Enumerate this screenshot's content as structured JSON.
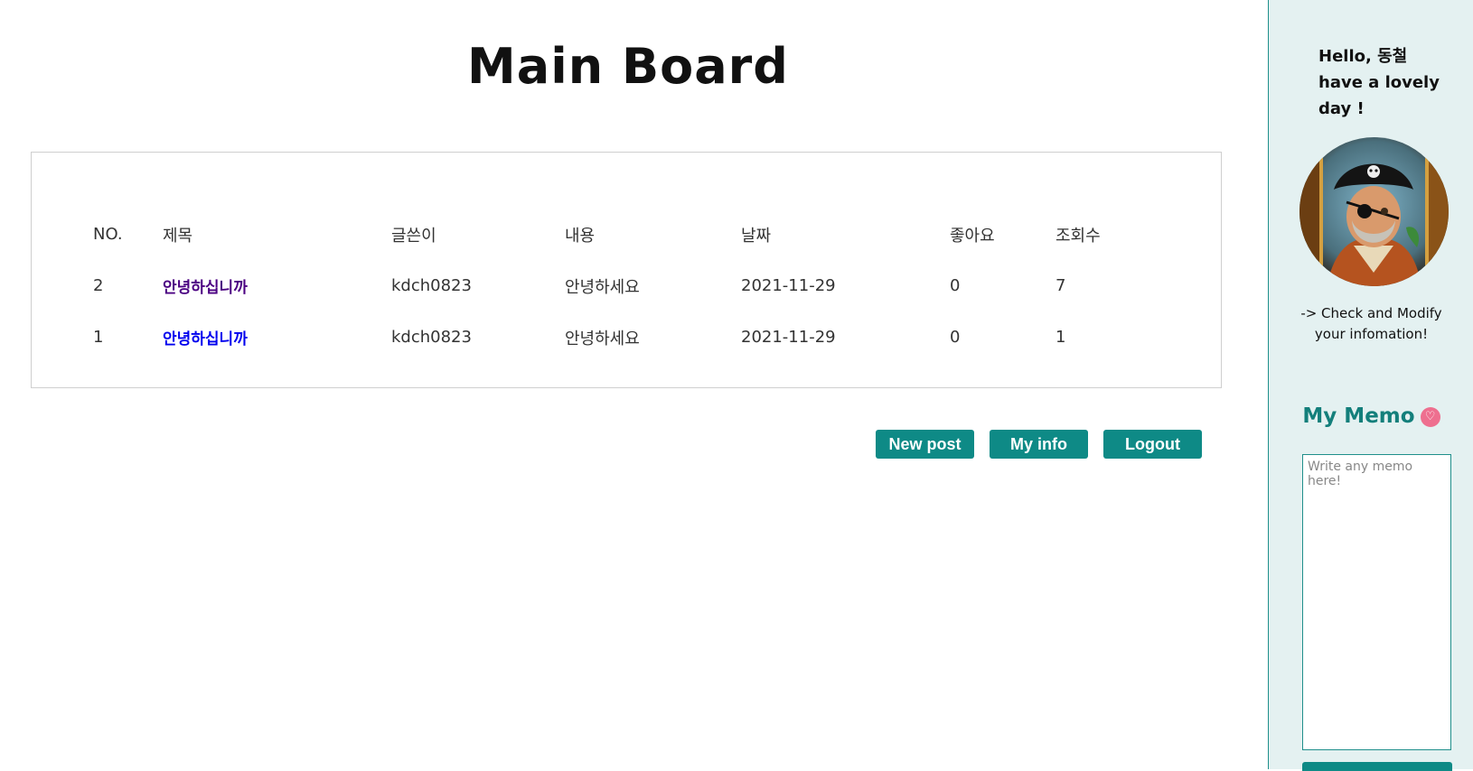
{
  "page": {
    "title": "Main Board"
  },
  "board": {
    "columns": [
      "NO.",
      "제목",
      "글쓴이",
      "내용",
      "날짜",
      "좋아요",
      "조회수"
    ],
    "rows": [
      {
        "no": "2",
        "title": "안녕하십니까",
        "author": "kdch0823",
        "content": "안녕하세요",
        "date": "2021-11-29",
        "likes": "0",
        "views": "7",
        "visited": true
      },
      {
        "no": "1",
        "title": "안녕하십니까",
        "author": "kdch0823",
        "content": "안녕하세요",
        "date": "2021-11-29",
        "likes": "0",
        "views": "1",
        "visited": false
      }
    ]
  },
  "actions": {
    "new_post": "New post",
    "my_info": "My info",
    "logout": "Logout"
  },
  "sidebar": {
    "greeting_line1": "Hello, 동철",
    "greeting_line2": "have a lovely day !",
    "avatar_icon": "pirate-portrait-icon",
    "info_line1": "-> Check and Modify",
    "info_line2": "your infomation!",
    "memo_title": "My Memo",
    "memo_icon": "heart-icon",
    "memo_placeholder": "Write any memo here!"
  },
  "colors": {
    "accent": "#0e8a86",
    "sidebar_bg": "#e4f1f1",
    "memo_title": "#137f7b",
    "heart": "#ee6f8f",
    "visited_link": "#4b0082",
    "link": "#0000ee"
  }
}
